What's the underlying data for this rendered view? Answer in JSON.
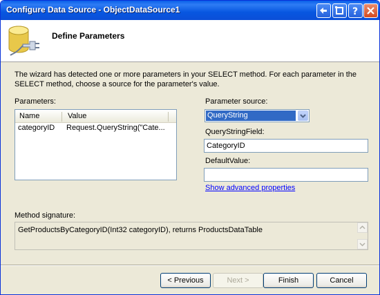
{
  "window": {
    "title": "Configure Data Source - ObjectDataSource1",
    "controls": [
      "help-icon",
      "back-icon",
      "restore-icon",
      "close-icon"
    ]
  },
  "header": {
    "heading": "Define Parameters",
    "icon": "database-icon"
  },
  "description": "The wizard has detected one or more parameters in your SELECT method. For each parameter in the SELECT method, choose a source for the parameter's value.",
  "parameters": {
    "label": "Parameters:",
    "columns": [
      "Name",
      "Value"
    ],
    "rows": [
      {
        "name": "categoryID",
        "value": "Request.QueryString(\"Cate..."
      }
    ]
  },
  "parameter_source": {
    "label": "Parameter source:",
    "selected": "QueryString"
  },
  "querystring_field": {
    "label": "QueryStringField:",
    "value": "CategoryID"
  },
  "default_value": {
    "label": "DefaultValue:",
    "value": ""
  },
  "advanced_link": "Show advanced properties",
  "method_signature": {
    "label": "Method signature:",
    "value": "GetProductsByCategoryID(Int32 categoryID), returns ProductsDataTable"
  },
  "buttons": {
    "previous": "< Previous",
    "next": "Next >",
    "finish": "Finish",
    "cancel": "Cancel"
  },
  "colors": {
    "titlebar": "#0a5fe9",
    "selection": "#316ac5",
    "link": "#0000ff"
  }
}
